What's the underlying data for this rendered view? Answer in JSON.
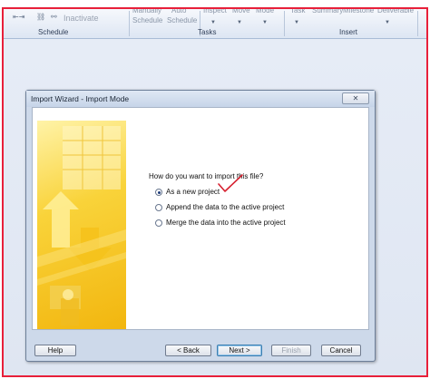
{
  "ribbon": {
    "top_items": [
      "Manually",
      "Auto",
      "Inspect",
      "Move",
      "Mode",
      "Task",
      "Summary",
      "Milestone",
      "Deliverable"
    ],
    "bottom_items": [
      "Schedule",
      "Schedule"
    ],
    "inactivate_label": "Inactivate",
    "groups": [
      "Schedule",
      "Tasks",
      "Insert"
    ]
  },
  "dialog": {
    "title": "Import Wizard - Import Mode",
    "question": "How do you want to import this file?",
    "options": [
      {
        "label": "As a new project",
        "checked": true
      },
      {
        "label": "Append the data to the active project",
        "checked": false
      },
      {
        "label": "Merge the data into the active project",
        "checked": false
      }
    ],
    "buttons": {
      "help": "Help",
      "back": "< Back",
      "next": "Next >",
      "finish": "Finish",
      "cancel": "Cancel"
    }
  },
  "colors": {
    "annotation_border": "#e8203a",
    "checkmark": "#d6202f"
  }
}
